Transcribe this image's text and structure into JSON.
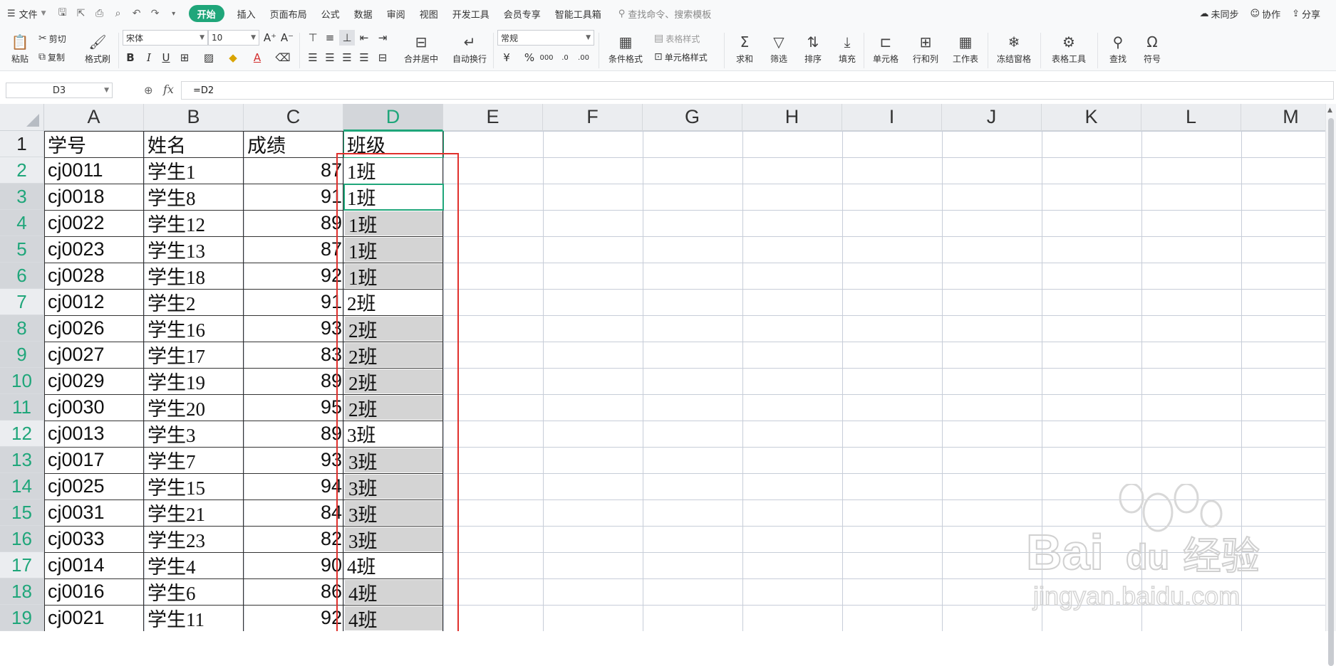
{
  "menu": {
    "file": "文件",
    "tabs": [
      "开始",
      "插入",
      "页面布局",
      "公式",
      "数据",
      "审阅",
      "视图",
      "开发工具",
      "会员专享",
      "智能工具箱"
    ],
    "search": "查找命令、搜索模板",
    "right": [
      "未同步",
      "协作",
      "分享"
    ]
  },
  "toolbar": {
    "paste": "粘贴",
    "cut": "剪切",
    "copy": "复制",
    "format_painter": "格式刷",
    "font_name": "宋体",
    "font_size": "10",
    "merge_center": "合并居中",
    "wrap_text": "自动换行",
    "number_format": "常规",
    "conditional_format": "条件格式",
    "table_style": "表格样式",
    "cell_style": "单元格样式",
    "sum": "求和",
    "filter": "筛选",
    "sort": "排序",
    "fill": "填充",
    "cell": "单元格",
    "row_col": "行和列",
    "worksheet": "工作表",
    "freeze": "冻结窗格",
    "table_tools": "表格工具",
    "find": "查找",
    "symbol": "符号"
  },
  "formula_bar": {
    "name_box": "D3",
    "fx": "fx",
    "formula": "=D2"
  },
  "sheet": {
    "columns": [
      "A",
      "B",
      "C",
      "D",
      "E",
      "F",
      "G",
      "H",
      "I",
      "J",
      "K",
      "L",
      "M"
    ],
    "selected_column": "D",
    "active_cell": "D3",
    "header": {
      "id": "学号",
      "name": "姓名",
      "score": "成绩",
      "class": "班级"
    },
    "rows": [
      {
        "row": "2",
        "id": "cj0011",
        "name": "学生1",
        "score": "87",
        "class": "1班"
      },
      {
        "row": "3",
        "id": "cj0018",
        "name": "学生8",
        "score": "91",
        "class": "1班"
      },
      {
        "row": "4",
        "id": "cj0022",
        "name": "学生12",
        "score": "89",
        "class": "1班"
      },
      {
        "row": "5",
        "id": "cj0023",
        "name": "学生13",
        "score": "87",
        "class": "1班"
      },
      {
        "row": "6",
        "id": "cj0028",
        "name": "学生18",
        "score": "92",
        "class": "1班"
      },
      {
        "row": "7",
        "id": "cj0012",
        "name": "学生2",
        "score": "91",
        "class": "2班"
      },
      {
        "row": "8",
        "id": "cj0026",
        "name": "学生16",
        "score": "93",
        "class": "2班"
      },
      {
        "row": "9",
        "id": "cj0027",
        "name": "学生17",
        "score": "83",
        "class": "2班"
      },
      {
        "row": "10",
        "id": "cj0029",
        "name": "学生19",
        "score": "89",
        "class": "2班"
      },
      {
        "row": "11",
        "id": "cj0030",
        "name": "学生20",
        "score": "95",
        "class": "2班"
      },
      {
        "row": "12",
        "id": "cj0013",
        "name": "学生3",
        "score": "89",
        "class": "3班"
      },
      {
        "row": "13",
        "id": "cj0017",
        "name": "学生7",
        "score": "93",
        "class": "3班"
      },
      {
        "row": "14",
        "id": "cj0025",
        "name": "学生15",
        "score": "94",
        "class": "3班"
      },
      {
        "row": "15",
        "id": "cj0031",
        "name": "学生21",
        "score": "84",
        "class": "3班"
      },
      {
        "row": "16",
        "id": "cj0033",
        "name": "学生23",
        "score": "82",
        "class": "3班"
      },
      {
        "row": "17",
        "id": "cj0014",
        "name": "学生4",
        "score": "90",
        "class": "4班"
      },
      {
        "row": "18",
        "id": "cj0016",
        "name": "学生6",
        "score": "86",
        "class": "4班"
      },
      {
        "row": "19",
        "id": "cj0021",
        "name": "学生11",
        "score": "92",
        "class": "4班"
      }
    ],
    "selected_rows": [
      "3",
      "4",
      "5",
      "6",
      "8",
      "9",
      "10",
      "11",
      "13",
      "14",
      "15",
      "16",
      "18",
      "19"
    ],
    "highlight_rows": [
      "2",
      "7",
      "12",
      "17"
    ],
    "grey_class_rows": [
      "4",
      "5",
      "6",
      "8",
      "9",
      "10",
      "11",
      "13",
      "14",
      "15",
      "16",
      "18",
      "19"
    ]
  },
  "colors": {
    "accent": "#1fa67a",
    "selection_border": "#1fa67a",
    "annotation_red": "#e0302c",
    "cell_grey": "#d4d4d4"
  },
  "watermark": {
    "brand": "Baidu经验",
    "url": "jingyan.baidu.com"
  }
}
